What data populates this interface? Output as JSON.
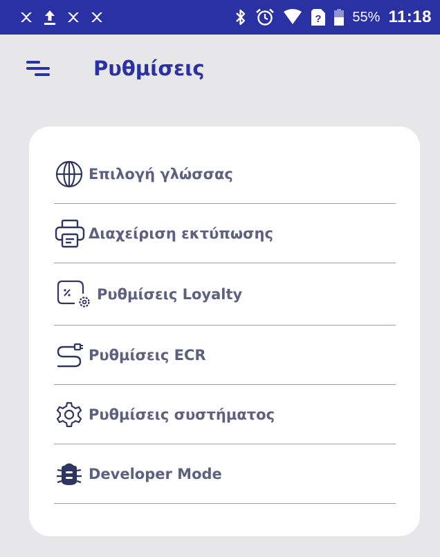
{
  "status_bar": {
    "battery_percent": "55%",
    "time": "11:18",
    "background_color": "#2a31a3"
  },
  "header": {
    "title": "Ρυθμίσεις",
    "menu_icon": "menu-icon"
  },
  "settings": {
    "items": [
      {
        "label": "Επιλογή γλώσσας",
        "icon": "globe-icon"
      },
      {
        "label": "Διαχείριση εκτύπωσης",
        "icon": "printer-icon"
      },
      {
        "label": "Ρυθμίσεις Loyalty",
        "icon": "loyalty-settings-icon"
      },
      {
        "label": "Ρυθμίσεις ECR",
        "icon": "ecr-cable-icon"
      },
      {
        "label": "Ρυθμίσεις συστήματος",
        "icon": "gear-icon"
      },
      {
        "label": "Developer Mode",
        "icon": "bug-icon"
      }
    ]
  },
  "colors": {
    "accent": "#2a31a3",
    "text": "#5d6180",
    "background": "#e7e7e9",
    "card": "#ffffff",
    "divider": "#9e9ea4"
  }
}
